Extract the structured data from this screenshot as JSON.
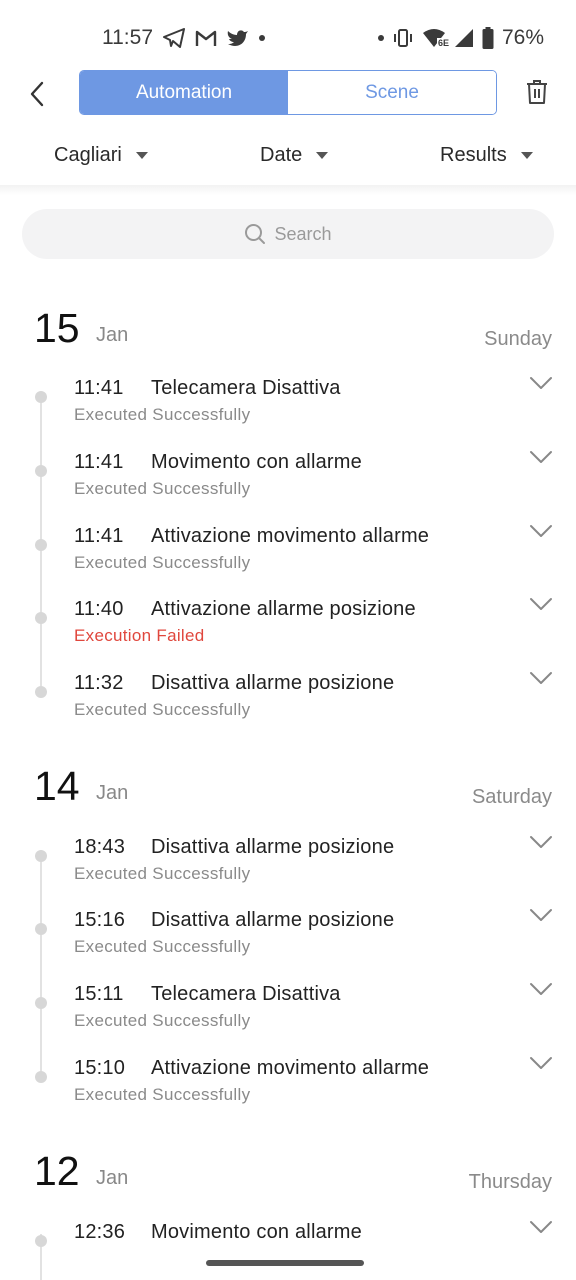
{
  "status_bar": {
    "time": "11:57",
    "battery": "76%",
    "network_label": "6E",
    "left_icons": [
      "telegram-icon",
      "gmail-icon",
      "twitter-icon",
      "notification-dot-icon"
    ],
    "right_icons": [
      "notification-dot-icon",
      "vibrate-icon",
      "wifi-6e-icon",
      "signal-icon",
      "battery-icon"
    ]
  },
  "header": {
    "back_icon": "chevron-left-icon",
    "tabs": [
      {
        "label": "Automation",
        "active": true
      },
      {
        "label": "Scene",
        "active": false
      }
    ],
    "delete_icon": "trash-icon"
  },
  "filters": [
    {
      "label": "Cagliari"
    },
    {
      "label": "Date"
    },
    {
      "label": "Results"
    }
  ],
  "search": {
    "placeholder": "Search",
    "icon": "search-icon"
  },
  "colors": {
    "accent": "#6e98e3",
    "failed": "#e0473d",
    "status_gray": "#8a8a8a"
  },
  "days": [
    {
      "day": "15",
      "month": "Jan",
      "weekday": "Sunday",
      "entries": [
        {
          "time": "11:41",
          "name": "Telecamera Disattiva",
          "status": "Executed Successfully",
          "failed": false
        },
        {
          "time": "11:41",
          "name": "Movimento con allarme",
          "status": "Executed Successfully",
          "failed": false
        },
        {
          "time": "11:41",
          "name": "Attivazione movimento allarme",
          "status": "Executed Successfully",
          "failed": false
        },
        {
          "time": "11:40",
          "name": "Attivazione allarme posizione",
          "status": "Execution Failed",
          "failed": true
        },
        {
          "time": "11:32",
          "name": "Disattiva allarme posizione",
          "status": "Executed Successfully",
          "failed": false
        }
      ]
    },
    {
      "day": "14",
      "month": "Jan",
      "weekday": "Saturday",
      "entries": [
        {
          "time": "18:43",
          "name": "Disattiva allarme posizione",
          "status": "Executed Successfully",
          "failed": false
        },
        {
          "time": "15:16",
          "name": "Disattiva allarme posizione",
          "status": "Executed Successfully",
          "failed": false
        },
        {
          "time": "15:11",
          "name": "Telecamera Disattiva",
          "status": "Executed Successfully",
          "failed": false
        },
        {
          "time": "15:10",
          "name": "Attivazione movimento allarme",
          "status": "Executed Successfully",
          "failed": false
        }
      ]
    },
    {
      "day": "12",
      "month": "Jan",
      "weekday": "Thursday",
      "entries": [
        {
          "time": "12:36",
          "name": "Movimento con allarme",
          "status": "",
          "failed": false
        }
      ]
    }
  ]
}
